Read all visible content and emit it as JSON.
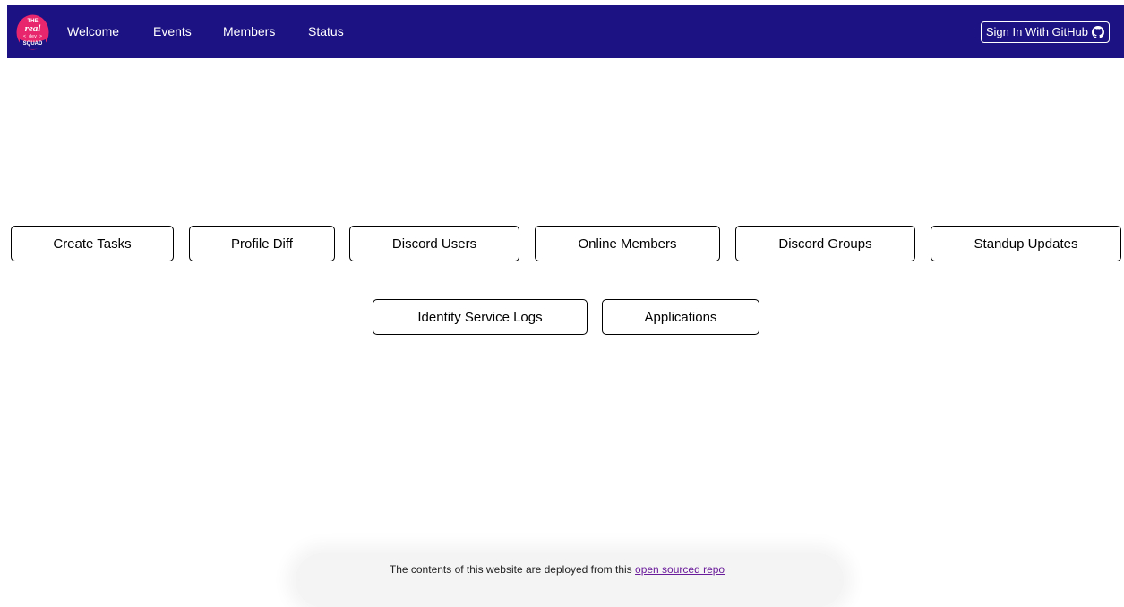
{
  "navbar": {
    "logo_text": [
      "THE",
      "real",
      "< dev >",
      "SQUAD"
    ],
    "links": [
      "Welcome",
      "Events",
      "Members",
      "Status"
    ],
    "signin_label": "Sign In With GitHub",
    "signin_icon": "github-icon",
    "background": "#1d1283"
  },
  "main": {
    "buttons_row1": [
      "Create Tasks",
      "Profile Diff",
      "Discord Users",
      "Online Members",
      "Discord Groups",
      "Standup Updates"
    ],
    "buttons_row2": [
      "Identity Service Logs",
      "Applications"
    ]
  },
  "footer": {
    "text": "The contents of this website are deployed from this",
    "link_text": "open sourced repo"
  }
}
